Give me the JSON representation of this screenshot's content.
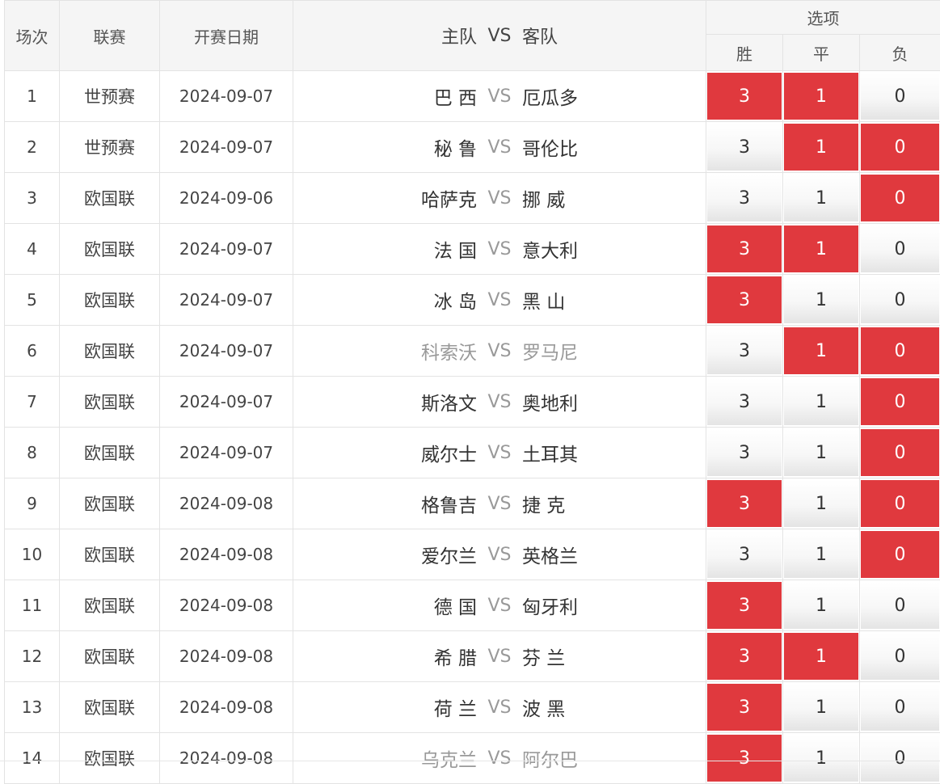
{
  "header": {
    "col_index": "场次",
    "col_league": "联赛",
    "col_date": "开赛日期",
    "col_home": "主队",
    "col_vs": "VS",
    "col_away": "客队",
    "col_options": "选项",
    "opt_win": "胜",
    "opt_draw": "平",
    "opt_loss": "负"
  },
  "colors": {
    "selected_bg": "#e0393e",
    "selected_text": "#ffffff",
    "muted_text": "#999999"
  },
  "rows": [
    {
      "idx": "1",
      "league": "世预赛",
      "date": "2024-09-07",
      "home": "巴 西",
      "vs": "VS",
      "away": "厄瓜多",
      "muted": false,
      "win": "3",
      "draw": "1",
      "loss": "0",
      "win_sel": true,
      "draw_sel": true,
      "loss_sel": false
    },
    {
      "idx": "2",
      "league": "世预赛",
      "date": "2024-09-07",
      "home": "秘 鲁",
      "vs": "VS",
      "away": "哥伦比",
      "muted": false,
      "win": "3",
      "draw": "1",
      "loss": "0",
      "win_sel": false,
      "draw_sel": true,
      "loss_sel": true
    },
    {
      "idx": "3",
      "league": "欧国联",
      "date": "2024-09-06",
      "home": "哈萨克",
      "vs": "VS",
      "away": "挪 威",
      "muted": false,
      "win": "3",
      "draw": "1",
      "loss": "0",
      "win_sel": false,
      "draw_sel": false,
      "loss_sel": true
    },
    {
      "idx": "4",
      "league": "欧国联",
      "date": "2024-09-07",
      "home": "法 国",
      "vs": "VS",
      "away": "意大利",
      "muted": false,
      "win": "3",
      "draw": "1",
      "loss": "0",
      "win_sel": true,
      "draw_sel": true,
      "loss_sel": false
    },
    {
      "idx": "5",
      "league": "欧国联",
      "date": "2024-09-07",
      "home": "冰 岛",
      "vs": "VS",
      "away": "黑 山",
      "muted": false,
      "win": "3",
      "draw": "1",
      "loss": "0",
      "win_sel": true,
      "draw_sel": false,
      "loss_sel": false
    },
    {
      "idx": "6",
      "league": "欧国联",
      "date": "2024-09-07",
      "home": "科索沃",
      "vs": "VS",
      "away": "罗马尼",
      "muted": true,
      "win": "3",
      "draw": "1",
      "loss": "0",
      "win_sel": false,
      "draw_sel": true,
      "loss_sel": true
    },
    {
      "idx": "7",
      "league": "欧国联",
      "date": "2024-09-07",
      "home": "斯洛文",
      "vs": "VS",
      "away": "奥地利",
      "muted": false,
      "win": "3",
      "draw": "1",
      "loss": "0",
      "win_sel": false,
      "draw_sel": false,
      "loss_sel": true
    },
    {
      "idx": "8",
      "league": "欧国联",
      "date": "2024-09-07",
      "home": "威尔士",
      "vs": "VS",
      "away": "土耳其",
      "muted": false,
      "win": "3",
      "draw": "1",
      "loss": "0",
      "win_sel": false,
      "draw_sel": false,
      "loss_sel": true
    },
    {
      "idx": "9",
      "league": "欧国联",
      "date": "2024-09-08",
      "home": "格鲁吉",
      "vs": "VS",
      "away": "捷 克",
      "muted": false,
      "win": "3",
      "draw": "1",
      "loss": "0",
      "win_sel": true,
      "draw_sel": false,
      "loss_sel": true
    },
    {
      "idx": "10",
      "league": "欧国联",
      "date": "2024-09-08",
      "home": "爱尔兰",
      "vs": "VS",
      "away": "英格兰",
      "muted": false,
      "win": "3",
      "draw": "1",
      "loss": "0",
      "win_sel": false,
      "draw_sel": false,
      "loss_sel": true
    },
    {
      "idx": "11",
      "league": "欧国联",
      "date": "2024-09-08",
      "home": "德 国",
      "vs": "VS",
      "away": "匈牙利",
      "muted": false,
      "win": "3",
      "draw": "1",
      "loss": "0",
      "win_sel": true,
      "draw_sel": false,
      "loss_sel": false
    },
    {
      "idx": "12",
      "league": "欧国联",
      "date": "2024-09-08",
      "home": "希 腊",
      "vs": "VS",
      "away": "芬 兰",
      "muted": false,
      "win": "3",
      "draw": "1",
      "loss": "0",
      "win_sel": true,
      "draw_sel": true,
      "loss_sel": false
    },
    {
      "idx": "13",
      "league": "欧国联",
      "date": "2024-09-08",
      "home": "荷 兰",
      "vs": "VS",
      "away": "波 黑",
      "muted": false,
      "win": "3",
      "draw": "1",
      "loss": "0",
      "win_sel": true,
      "draw_sel": false,
      "loss_sel": false
    },
    {
      "idx": "14",
      "league": "欧国联",
      "date": "2024-09-08",
      "home": "乌克兰",
      "vs": "VS",
      "away": "阿尔巴",
      "muted": true,
      "win": "3",
      "draw": "1",
      "loss": "0",
      "win_sel": true,
      "draw_sel": false,
      "loss_sel": false
    }
  ]
}
